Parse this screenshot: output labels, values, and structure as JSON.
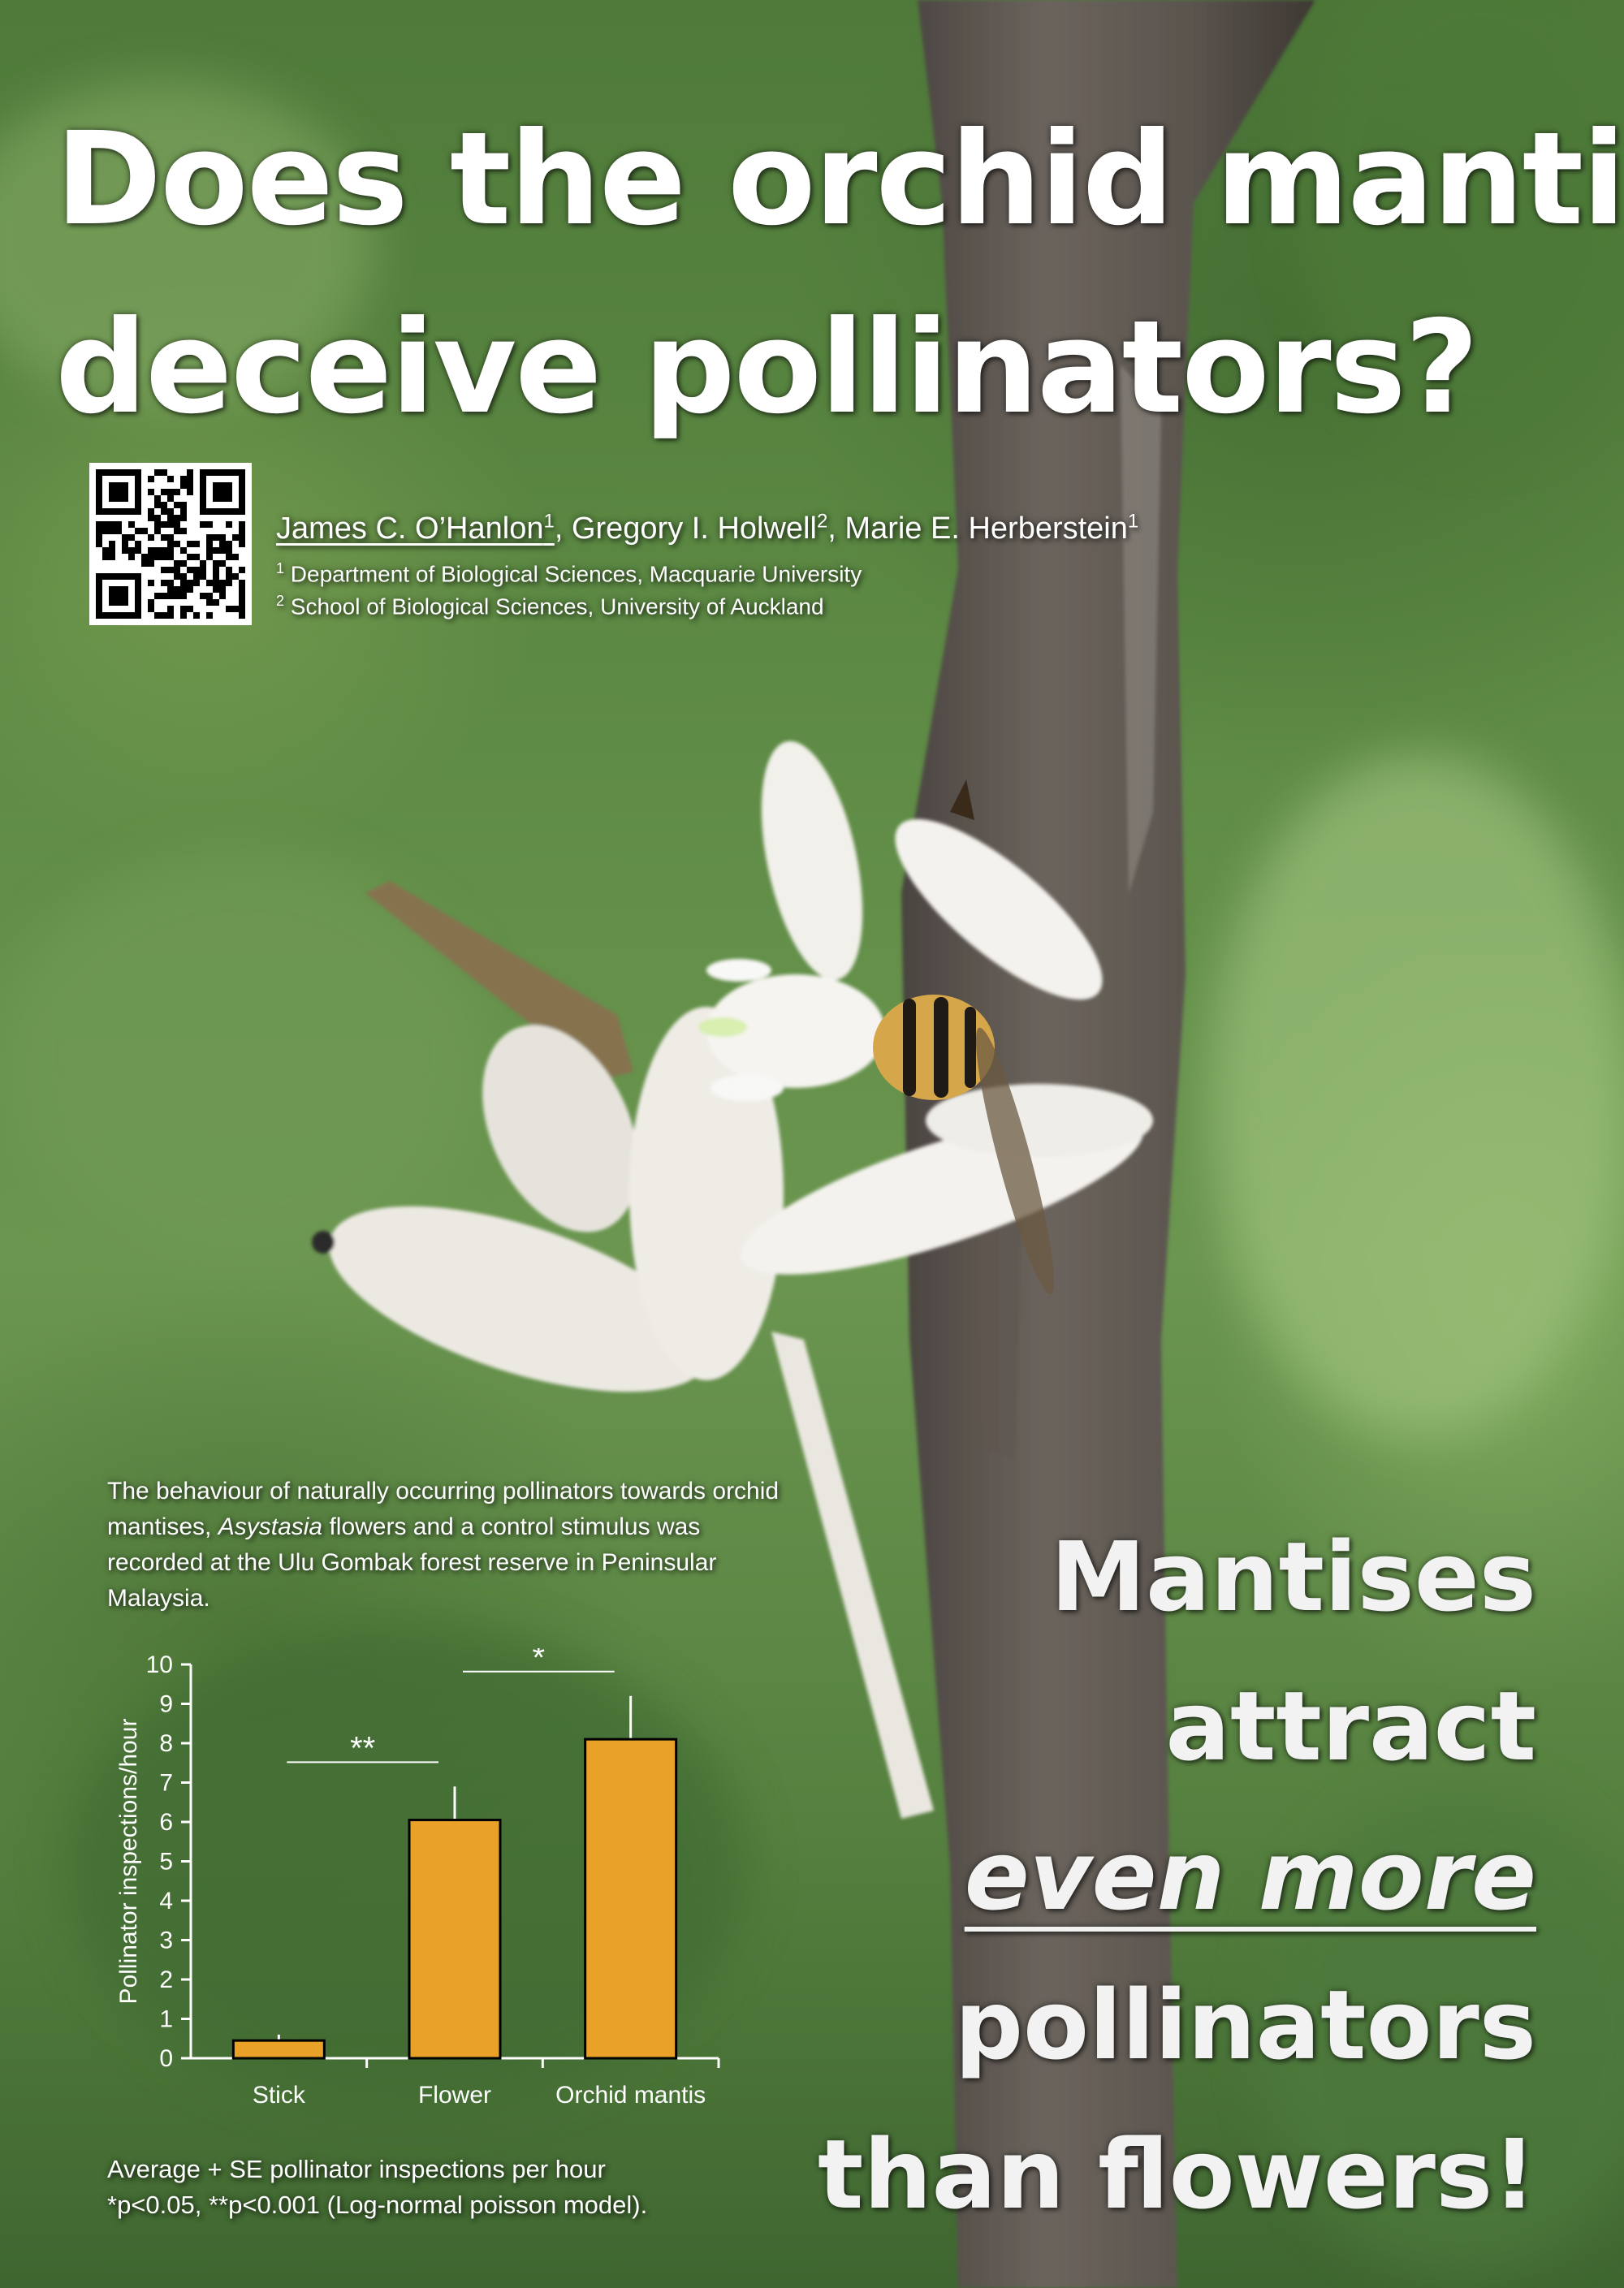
{
  "colors": {
    "bar": "#e9a227",
    "axis": "#ffffff",
    "text": "#ffffff"
  },
  "title": {
    "line1": "Does the orchid mantis",
    "line2": "deceive pollinators?"
  },
  "qr_code": {
    "icon": "qr-code-icon"
  },
  "authors": {
    "a1": "James C. O’Hanlon",
    "a1_sup": "1",
    "a2": "Gregory I. Holwell",
    "a2_sup": "2",
    "a3": "Marie E. Herberstein",
    "a3_sup": "1",
    "sep": ", "
  },
  "affiliations": [
    {
      "sup": "1",
      "text": "Department of Biological Sciences, Macquarie University"
    },
    {
      "sup": "2",
      "text": "School of Biological Sciences, University of Auckland"
    }
  ],
  "intro": {
    "before": "The behaviour of naturally occurring pollinators towards orchid mantises, ",
    "italic": "Asystasia",
    "after": " flowers and a control stimulus was recorded at the Ulu Gombak forest reserve in Peninsular Malaysia."
  },
  "chart_data": {
    "type": "bar",
    "categories": [
      "Stick",
      "Flower",
      "Orchid mantis"
    ],
    "values": [
      0.45,
      6.05,
      8.1
    ],
    "errors": [
      0.15,
      0.85,
      1.1
    ],
    "ylabel": "Pollinator inspections/hour",
    "xlabel": "",
    "ylim": [
      0,
      10
    ],
    "yticks": [
      "0",
      "1",
      "2",
      "3",
      "4",
      "5",
      "6",
      "7",
      "8",
      "9",
      "10"
    ],
    "significance": [
      {
        "from": "Stick",
        "to": "Flower",
        "label": "**"
      },
      {
        "from": "Flower",
        "to": "Orchid mantis",
        "label": "*"
      }
    ]
  },
  "caption": {
    "line1": "Average + SE pollinator inspections per hour",
    "line2": "*p<0.05, **p<0.001 (Log-normal poisson model)."
  },
  "headline": {
    "line1": "Mantises",
    "line2": "attract",
    "line3": "even more",
    "line4": "pollinators",
    "line5": "than flowers!"
  }
}
